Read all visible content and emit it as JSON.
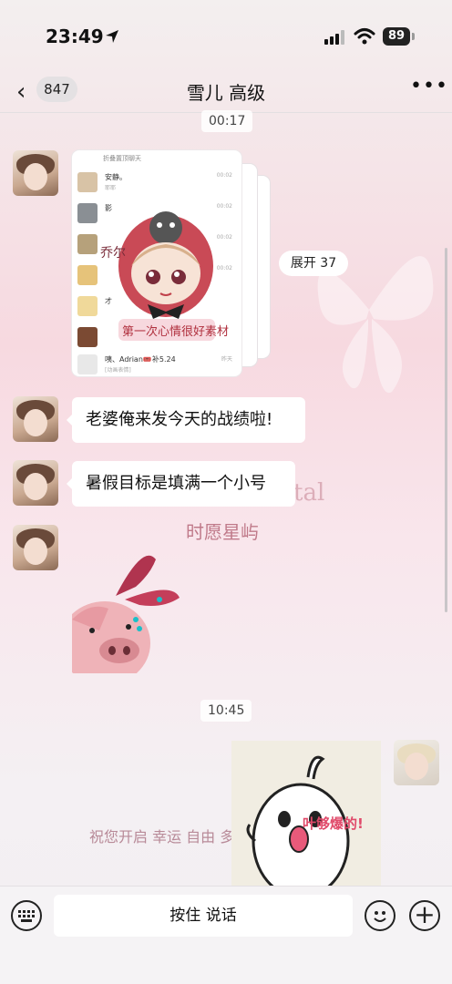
{
  "status_bar": {
    "time": "23:49",
    "battery": "89"
  },
  "nav": {
    "unread_count": "847",
    "title": "雪儿 高级"
  },
  "timestamps": [
    "00:17",
    "10:45"
  ],
  "forwarded_card": {
    "header": "折叠置顶聊天",
    "rows": [
      {
        "name": "安静。",
        "sub": "耶耶",
        "time": "00:02"
      },
      {
        "name": "影",
        "sub": "",
        "time": "00:02"
      },
      {
        "name": "",
        "sub": "",
        "time": "00:02"
      },
      {
        "name": "",
        "sub": "",
        "time": "00:02"
      },
      {
        "name": "才",
        "sub": "",
        "time": ""
      },
      {
        "name": "",
        "sub": "",
        "time": ""
      },
      {
        "name": "咦、Adrian🎟️补5.24",
        "sub": "[动画表情]",
        "time": "昨天"
      }
    ],
    "sticker_text_top": "乔尔",
    "sticker_text_bottom": "第一次心情很好素材"
  },
  "expand_button": "展开 37",
  "messages": [
    {
      "text": "老婆俺来发今天的战绩啦!"
    },
    {
      "text": "暑假目标是填满一个小号"
    }
  ],
  "background_texts": {
    "partial": "tal",
    "wish": "时愿星屿",
    "blessing": "祝您开启 幸运 自由 多"
  },
  "my_sticker_caption": "叶够爆的!",
  "input_bar": {
    "voice_label": "按住 说话"
  }
}
